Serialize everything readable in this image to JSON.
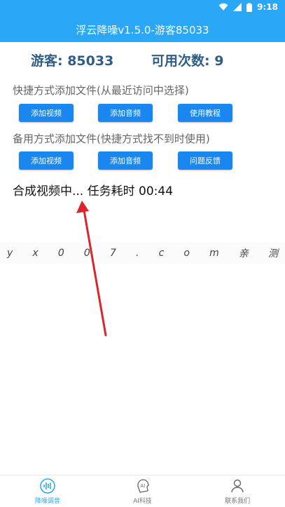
{
  "status": {
    "time": "9:18"
  },
  "app": {
    "title": "浮云降噪v1.5.0-游客85033"
  },
  "info": {
    "guest": "游客: 85033",
    "count": "可用次数: 9"
  },
  "section1": {
    "label": "快捷方式添加文件(从最近访问中选择)",
    "buttons": [
      "添加视频",
      "添加音频",
      "使用教程"
    ]
  },
  "section2": {
    "label": "备用方式添加文件(快捷方式找不到时使用)",
    "buttons": [
      "添加视频",
      "添加音频",
      "问题反馈"
    ]
  },
  "progress": {
    "text": "合成视频中... 任务耗时 00:44"
  },
  "watermark": {
    "chars": [
      "y",
      "x",
      "0",
      "0",
      "7",
      ".",
      "c",
      "o",
      "m",
      "亲",
      "测"
    ]
  },
  "nav": {
    "items": [
      {
        "label": "降噪调音",
        "icon": "waveform-icon"
      },
      {
        "label": "AI科技",
        "icon": "ai-icon"
      },
      {
        "label": "联系我们",
        "icon": "person-icon"
      }
    ]
  },
  "colors": {
    "primary": "#2aa7f6",
    "button": "#1a86f0",
    "arrow": "#d9252b",
    "info_text": "#2f5d86"
  }
}
